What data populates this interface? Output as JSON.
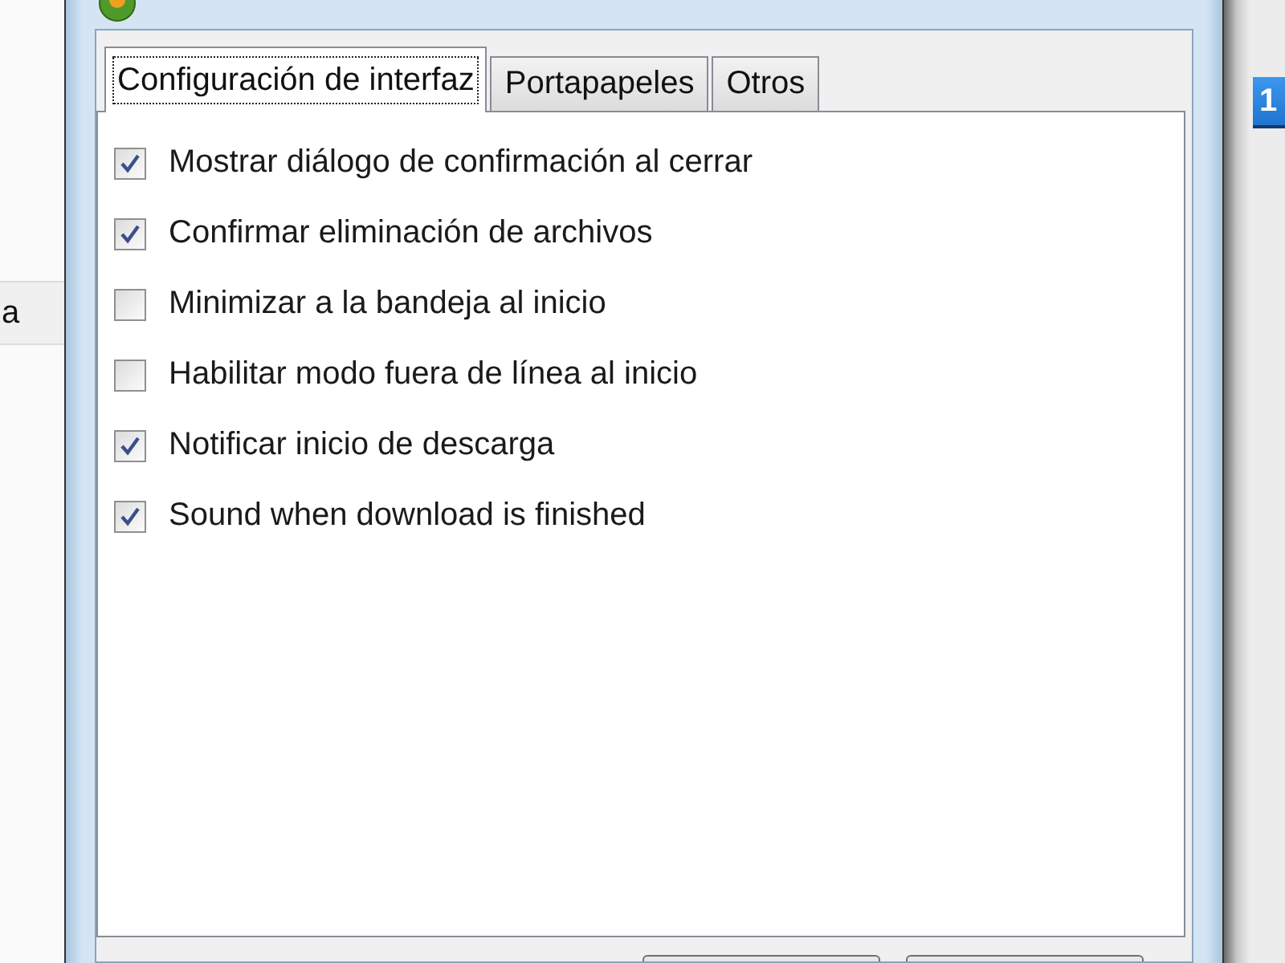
{
  "background_left": {
    "row_text": "a"
  },
  "background_right": {
    "badge": "1"
  },
  "dialog": {
    "tabs": [
      {
        "label": "Configuración de interfaz",
        "selected": true
      },
      {
        "label": "Portapapeles",
        "selected": false
      },
      {
        "label": "Otros",
        "selected": false
      }
    ],
    "options": [
      {
        "label": "Mostrar diálogo de confirmación al cerrar",
        "checked": true
      },
      {
        "label": "Confirmar eliminación de archivos",
        "checked": true
      },
      {
        "label": "Minimizar a la bandeja al inicio",
        "checked": false
      },
      {
        "label": "Habilitar modo fuera de línea al inicio",
        "checked": false
      },
      {
        "label": "Notificar inicio de descarga",
        "checked": true
      },
      {
        "label": "Sound when download is finished",
        "checked": true
      }
    ]
  }
}
